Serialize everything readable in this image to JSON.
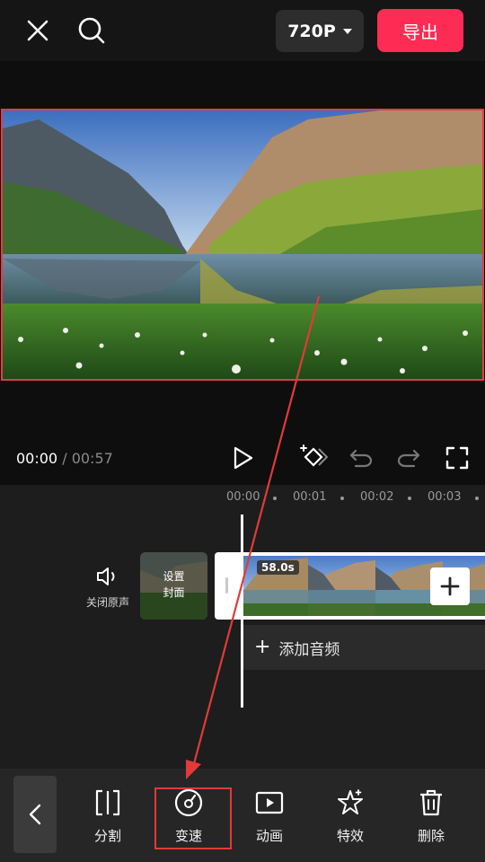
{
  "header": {
    "close_icon": "close-icon",
    "search_icon": "search-icon",
    "resolution": "720P",
    "export_label": "导出"
  },
  "playback": {
    "current_time": "00:00",
    "separator": "/",
    "total_time": "00:57"
  },
  "ruler": {
    "ticks": [
      "00:00",
      "00:01",
      "00:02",
      "00:03"
    ]
  },
  "track": {
    "mute_label": "关闭原声",
    "cover_line1": "设置",
    "cover_line2": "封面",
    "clip_duration": "58.0s",
    "add_audio_label": "添加音频"
  },
  "toolbar": {
    "items": [
      {
        "label": "分割",
        "icon": "split-icon"
      },
      {
        "label": "变速",
        "icon": "speed-icon"
      },
      {
        "label": "动画",
        "icon": "animation-icon"
      },
      {
        "label": "特效",
        "icon": "effects-icon"
      },
      {
        "label": "删除",
        "icon": "delete-icon"
      }
    ]
  },
  "colors": {
    "export": "#fe2c55",
    "highlight": "#e23a3a",
    "preview_border": "#e33b4a"
  }
}
